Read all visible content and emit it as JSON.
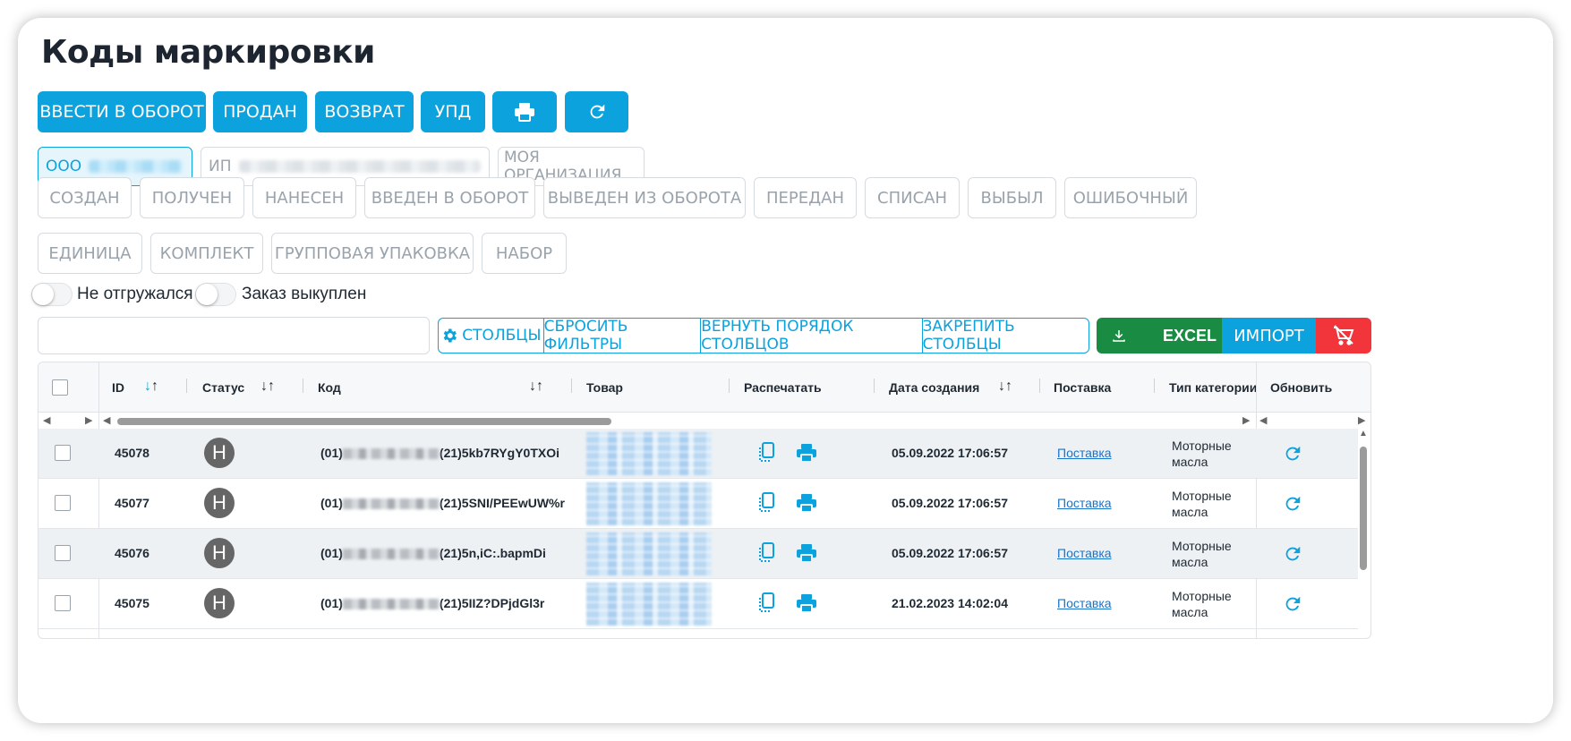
{
  "page": {
    "title": "Коды маркировки"
  },
  "actions": {
    "enter_circulation": "ВВЕСТИ В ОБОРОТ",
    "sold": "ПРОДАН",
    "return": "ВОЗВРАТ",
    "upd": "УПД",
    "print_icon": "printer-icon",
    "refresh_icon": "refresh-icon"
  },
  "orgs": [
    {
      "label": "ООО",
      "active": true
    },
    {
      "label": "ИП",
      "active": false
    },
    {
      "label": "МОЯ ОРГАНИЗАЦИЯ",
      "active": false
    }
  ],
  "status_filters": [
    "СОЗДАН",
    "ПОЛУЧЕН",
    "НАНЕСЕН",
    "ВВЕДЕН В ОБОРОТ",
    "ВЫВЕДЕН ИЗ ОБОРОТА",
    "ПЕРЕДАН",
    "СПИСАН",
    "ВЫБЫЛ",
    "ОШИБОЧНЫЙ"
  ],
  "type_filters": [
    "ЕДИНИЦА",
    "КОМПЛЕКТ",
    "ГРУППОВАЯ УПАКОВКА",
    "НАБОР"
  ],
  "toggles": [
    {
      "label": "Не отгружался",
      "on": false
    },
    {
      "label": "Заказ выкуплен",
      "on": false
    }
  ],
  "search": {
    "value": "",
    "placeholder": ""
  },
  "toolbar": {
    "columns": "СТОЛБЦЫ",
    "reset_filters": "СБРОСИТЬ ФИЛЬТРЫ",
    "restore_order": "ВЕРНУТЬ ПОРЯДОК СТОЛБЦОВ",
    "pin_columns": "ЗАКРЕПИТЬ СТОЛБЦЫ",
    "excel": "EXCEL",
    "import": "ИМПОРТ"
  },
  "colors": {
    "accent": "#0ba2de",
    "excel": "#1a8b43",
    "danger": "#f2353a"
  },
  "table": {
    "columns": [
      "ID",
      "Статус",
      "Код",
      "Товар",
      "Распечатать",
      "Дата создания",
      "Поставка",
      "Тип категории",
      "Обновить"
    ],
    "rows": [
      {
        "id": "45078",
        "status": "Н",
        "code_prefix": "(01)",
        "code_suffix": "(21)5kb7RYgY0TXOi",
        "date": "05.09.2022 17:06:57",
        "supply": "Поставка",
        "category": "Моторные масла"
      },
      {
        "id": "45077",
        "status": "Н",
        "code_prefix": "(01)",
        "code_suffix": "(21)5SNI/PEEwUW%r",
        "date": "05.09.2022 17:06:57",
        "supply": "Поставка",
        "category": "Моторные масла"
      },
      {
        "id": "45076",
        "status": "Н",
        "code_prefix": "(01)",
        "code_suffix": "(21)5n,iC:.bapmDi",
        "date": "05.09.2022 17:06:57",
        "supply": "Поставка",
        "category": "Моторные масла"
      },
      {
        "id": "45075",
        "status": "Н",
        "code_prefix": "(01)",
        "code_suffix": "(21)5IIZ?DPjdGl3r",
        "date": "21.02.2023 14:02:04",
        "supply": "Поставка",
        "category": "Моторные масла"
      }
    ]
  }
}
